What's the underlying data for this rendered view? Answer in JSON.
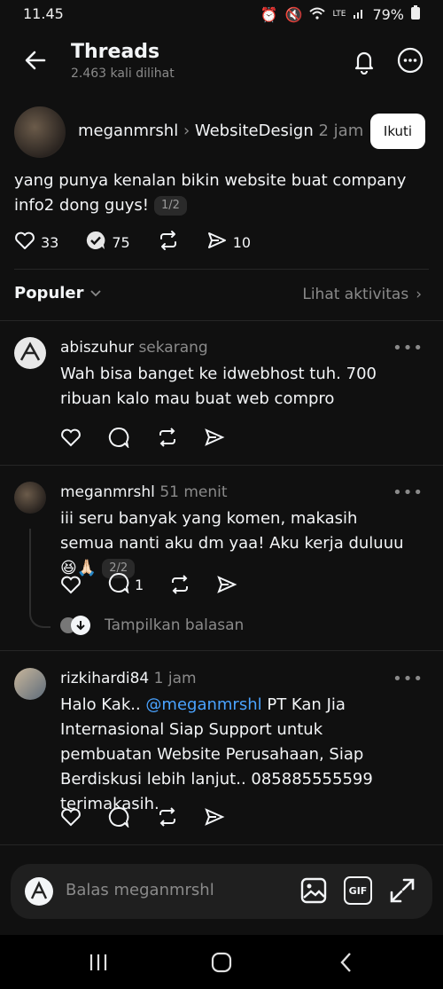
{
  "status_bar": {
    "time": "11.45",
    "battery": "79%",
    "network": "LTE"
  },
  "header": {
    "title": "Threads",
    "views": "2.463 kali dilihat"
  },
  "post": {
    "author": "meganmrshl",
    "community": "WebsiteDesign",
    "time": "2 jam",
    "follow_label": "Ikuti",
    "text": "yang punya kenalan bikin website buat company info2 dong guys!",
    "part": "1/2",
    "likes": "33",
    "comments": "75",
    "shares": "10"
  },
  "sort": {
    "label": "Populer",
    "activity": "Lihat aktivitas"
  },
  "replies": [
    {
      "author": "abiszuhur",
      "time": "sekarang",
      "text": "Wah bisa banget ke idwebhost tuh. 700 ribuan kalo mau buat web compro"
    },
    {
      "author": "meganmrshl",
      "time": "51 menit",
      "text": "iii seru banyak yang komen, makasih semua nanti aku dm yaa! Aku kerja duluuu 😆🙏🏻",
      "part": "2/2",
      "comment_count": "1",
      "show_replies": "Tampilkan balasan"
    },
    {
      "author": "rizkihardi84",
      "time": "1 jam",
      "text_prefix": "Halo Kak.. ",
      "mention": "@meganmrshl",
      "text_suffix": " PT Kan Jia Internasional Siap Support untuk pembuatan Website Perusahaan, Siap Berdiskusi lebih lanjut.. 085885555599 terimakasih."
    }
  ],
  "reply_bar": {
    "placeholder": "Balas meganmrshl",
    "gif_label": "GIF"
  },
  "colors": {
    "background": "#101010",
    "text": "#f3f5f7",
    "muted": "#8a8a8a",
    "mention": "#4aa3ff"
  }
}
